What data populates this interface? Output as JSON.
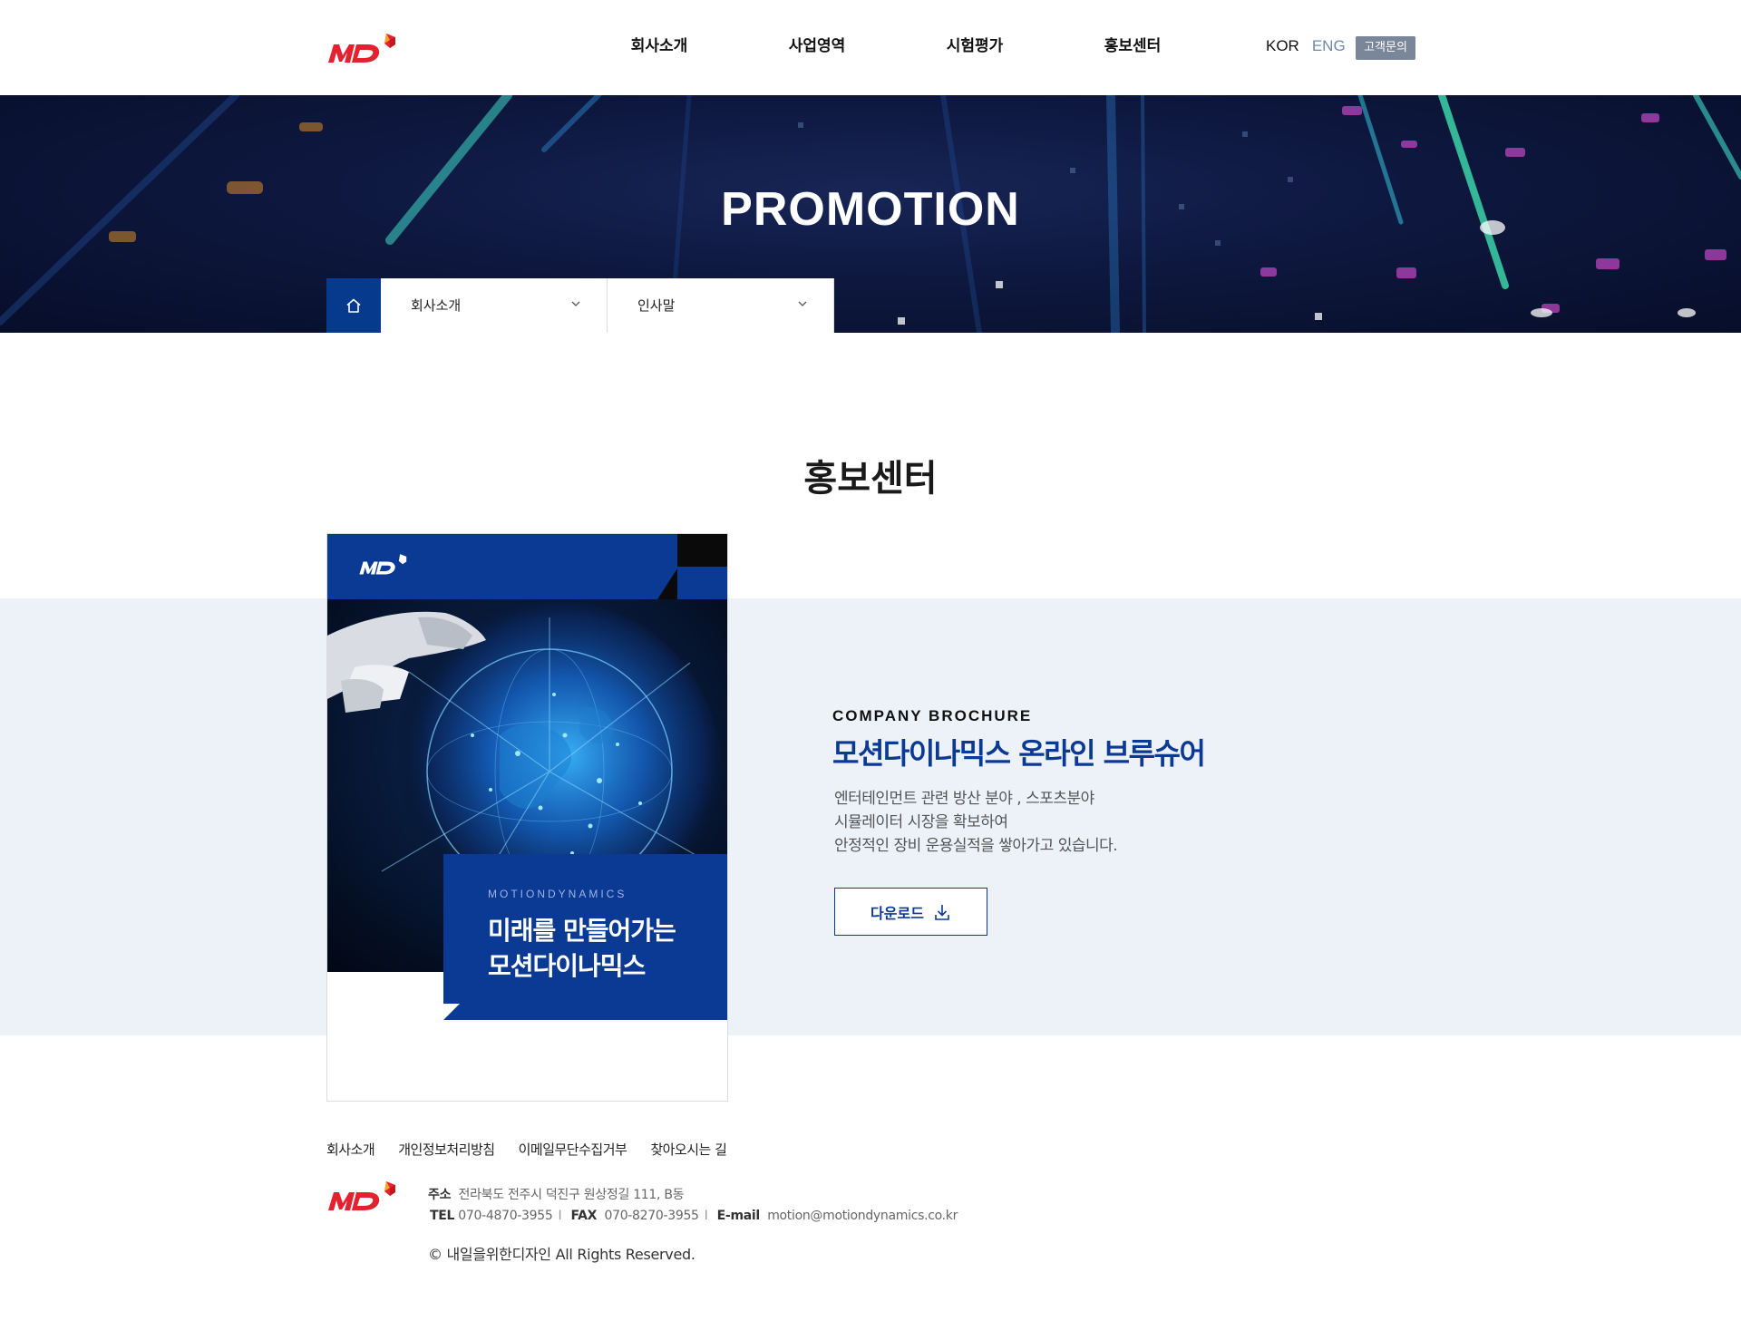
{
  "header": {
    "logo_text": "MD",
    "nav": [
      "회사소개",
      "사업영역",
      "시험평가",
      "홍보센터"
    ],
    "lang_kor": "KOR",
    "lang_eng": "ENG",
    "contact_button": "고객문의"
  },
  "hero": {
    "title": "PROMOTION",
    "location": {
      "home_icon": "home-icon",
      "depth1": "회사소개",
      "depth2": "인사말"
    }
  },
  "main": {
    "section_title": "홍보센터",
    "brochure": {
      "logo_text": "MD",
      "cover_subtitle": "MOTIONDYNAMICS",
      "cover_headline_1": "미래를 만들어가는",
      "cover_headline_2": "모션다이나믹스"
    },
    "kicker": "COMPANY BROCHURE",
    "headline": "모션다이나믹스 온라인 브루슈어",
    "description": [
      "엔터테인먼트 관련 방산 분야 , 스포츠분야",
      "시뮬레이터 시장을 확보하여",
      "안정적인 장비 운용실적을 쌓아가고 있습니다."
    ],
    "download_label": "다운로드"
  },
  "footer": {
    "links": [
      "회사소개",
      "개인정보처리방침",
      "이메일무단수집거부",
      "찾아오시는 길"
    ],
    "address_label": "주소",
    "address": "전라북도 전주시 덕진구 원상정길 111, B동",
    "tel_label": "TEL",
    "tel": "070-4870-3955",
    "fax_label": "FAX",
    "fax": "070-8270-3955",
    "email_label": "E-mail",
    "email": "motion@motiondynamics.co.kr",
    "copyright": "© 내일을위한디자인  All Rights Reserved."
  },
  "colors": {
    "brand_blue": "#0b3a94",
    "brand_red": "#e3212f",
    "band_bg": "#edf1f8",
    "contact_btn_bg": "#7a8699"
  }
}
